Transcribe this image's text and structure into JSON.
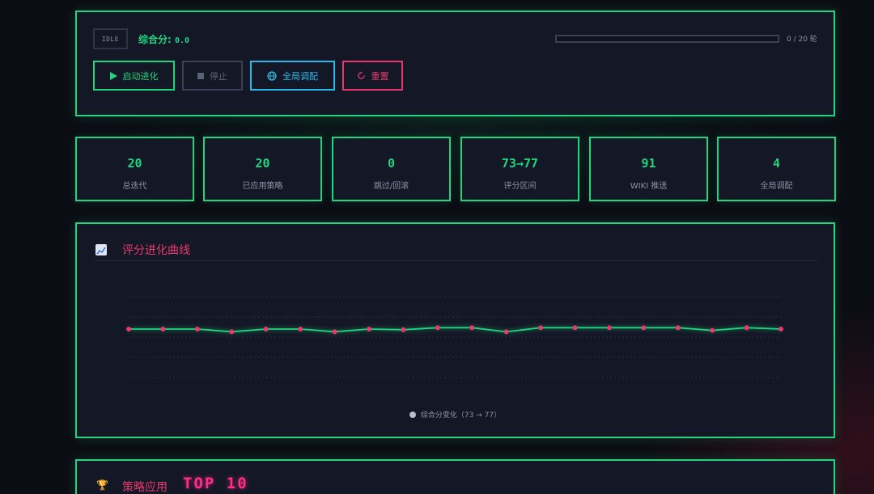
{
  "control": {
    "status": "IDLE",
    "score_label": "综合分:",
    "score_value": "0.0",
    "progress_fraction": 0,
    "progress_text": "0 / 20 轮",
    "buttons": {
      "start": "启动进化",
      "stop": "停止",
      "global": "全局调配",
      "reset": "重置"
    }
  },
  "stats": [
    {
      "value": "20",
      "label": "总迭代"
    },
    {
      "value": "20",
      "label": "已应用策略"
    },
    {
      "value": "0",
      "label": "跳过/回滚"
    },
    {
      "value": "73→77",
      "label": "评分区间"
    },
    {
      "value": "91",
      "label": "WIKI 推送"
    },
    {
      "value": "4",
      "label": "全局调配"
    }
  ],
  "chart": {
    "title": "评分进化曲线",
    "legend": "综合分变化（73 → 77）",
    "colors": {
      "line": "#1fd67f",
      "point": "#e8386f"
    }
  },
  "chart_data": {
    "type": "line",
    "x": [
      1,
      2,
      3,
      4,
      5,
      6,
      7,
      8,
      9,
      10,
      11,
      12,
      13,
      14,
      15,
      16,
      17,
      18,
      19,
      20
    ],
    "series": [
      {
        "name": "综合分变化（73 → 77）",
        "values": [
          76,
          76,
          76,
          74,
          76,
          76,
          74,
          76,
          75.5,
          77,
          77,
          74,
          77,
          77,
          77,
          77,
          77,
          75,
          77,
          76
        ]
      }
    ],
    "ylim": [
      40,
      100
    ],
    "grid": true
  },
  "strategy": {
    "title": "策略应用",
    "highlight": "TOP 10"
  }
}
